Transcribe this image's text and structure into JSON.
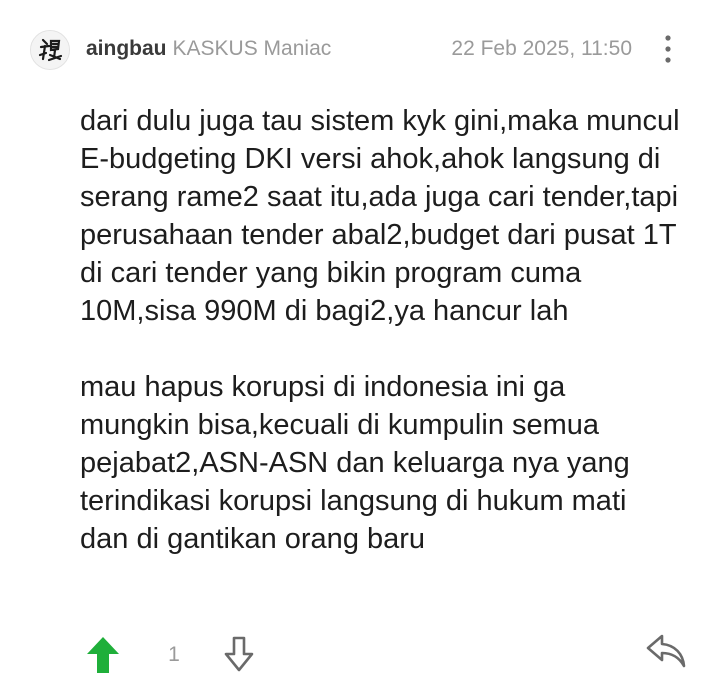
{
  "post": {
    "author": {
      "username": "aingbau",
      "rank": "KASKUS Maniac"
    },
    "timestamp": "22 Feb 2025, 11:50",
    "paragraphs": [
      "dari dulu juga tau sistem kyk gini,maka muncul E-budgeting DKI versi ahok,ahok langsung di serang rame2 saat itu,ada juga cari tender,tapi perusahaan tender abal2,budget dari pusat 1T di cari tender yang bikin program cuma 10M,sisa 990M di bagi2,ya hancur lah",
      "mau hapus korupsi di indonesia ini ga mungkin bisa,kecuali di kumpulin semua pejabat2,ASN-ASN dan keluarga nya yang terindikasi korupsi langsung di hukum mati dan di gantikan orang baru"
    ],
    "votes": {
      "count": "1"
    }
  },
  "icons": {
    "more": "more-vertical-icon",
    "upvote": "arrow-up-icon",
    "downvote": "arrow-down-icon",
    "reply": "reply-icon"
  },
  "colors": {
    "upvote_active": "#1faf3a",
    "muted_text": "#9a9a9a",
    "body_text": "#1d1d1d",
    "icon_gray": "#6a6a6a"
  }
}
